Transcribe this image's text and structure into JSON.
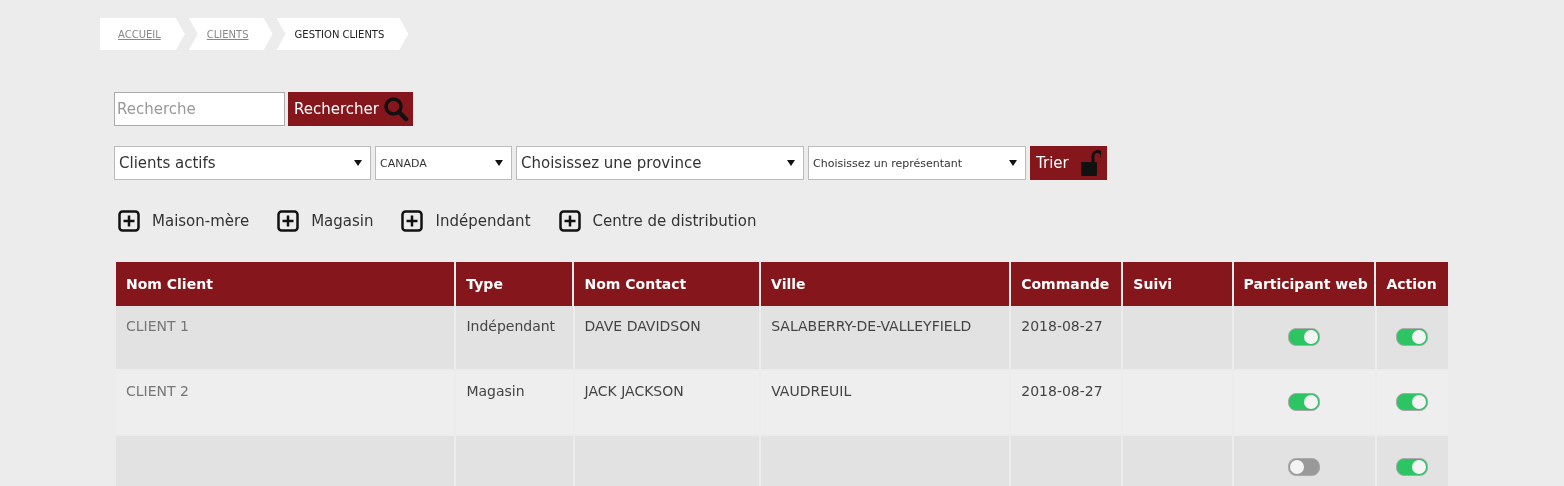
{
  "breadcrumbs": [
    {
      "label": "ACCUEIL",
      "link": true
    },
    {
      "label": "CLIENTS",
      "link": true
    },
    {
      "label": "GESTION CLIENTS",
      "link": false
    }
  ],
  "search": {
    "placeholder": "Recherche",
    "button": "Rechercher"
  },
  "filters": [
    "Clients actifs",
    "CANADA",
    "Choisissez une province",
    "Choisissez un représentant"
  ],
  "sort_button": "Trier",
  "add_links": [
    "Maison-mère",
    "Magasin",
    "Indépendant",
    "Centre de distribution"
  ],
  "table": {
    "columns": [
      "Nom Client",
      "Type",
      "Nom Contact",
      "Ville",
      "Commande",
      "Suivi",
      "Participant web",
      "Action"
    ],
    "rows": [
      {
        "client": "CLIENT 1",
        "type": "Indépendant",
        "contact": "DAVE DAVIDSON",
        "city": "SALABERRY-DE-VALLEYFIELD",
        "order": "2018-08-27",
        "web_on": true,
        "action_on": true
      },
      {
        "client": "CLIENT 2",
        "type": "Magasin",
        "contact": "JACK JACKSON",
        "city": "VAUDREUIL",
        "order": "2018-08-27",
        "web_on": true,
        "action_on": true
      },
      {
        "web_on": false,
        "action_on": true
      }
    ]
  }
}
